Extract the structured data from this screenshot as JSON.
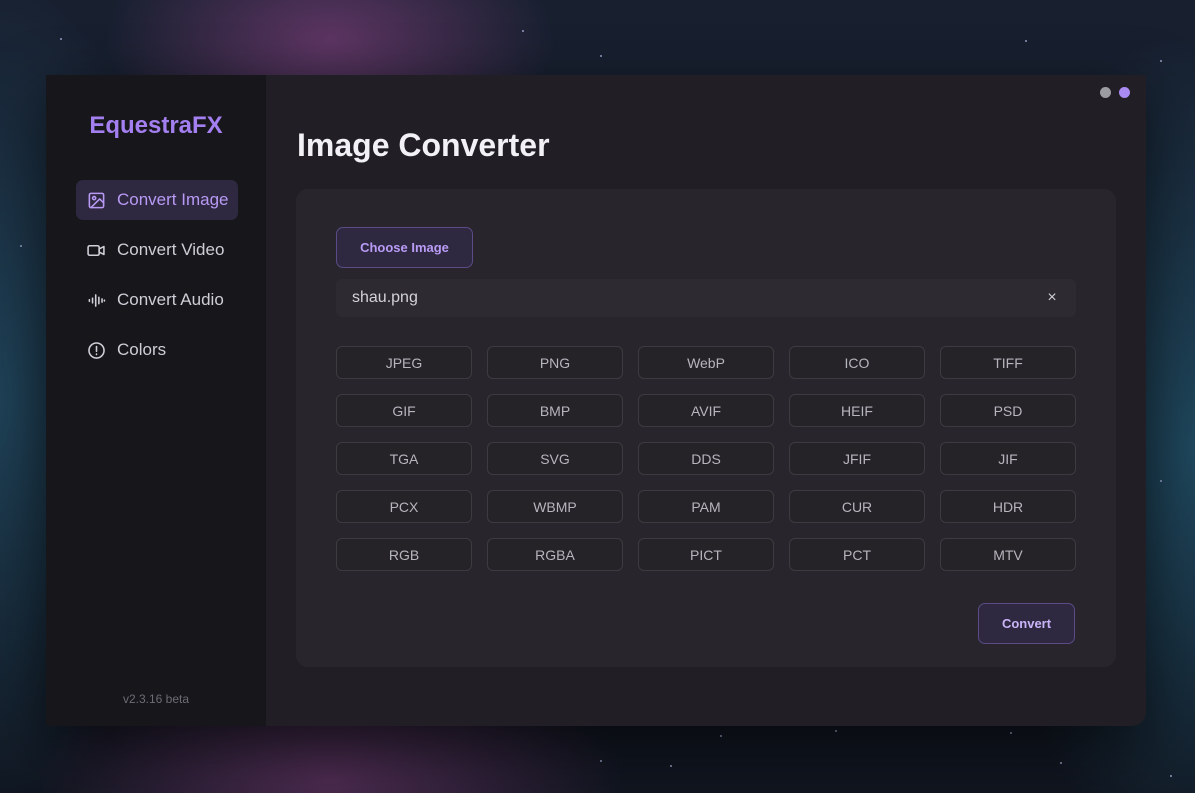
{
  "app": {
    "brand": "EquestraFX",
    "version": "v2.3.16 beta"
  },
  "sidebar": {
    "items": [
      {
        "label": "Convert Image",
        "icon": "image-icon",
        "active": true
      },
      {
        "label": "Convert Video",
        "icon": "video-camera-icon",
        "active": false
      },
      {
        "label": "Convert Audio",
        "icon": "audio-waveform-icon",
        "active": false
      },
      {
        "label": "Colors",
        "icon": "alert-circle-icon",
        "active": false
      }
    ]
  },
  "window_controls": {
    "dot1_color": "#9e9ca3",
    "dot2_color": "#a98bf2"
  },
  "main": {
    "title": "Image Converter",
    "choose_label": "Choose Image",
    "file_name": "shau.png",
    "clear_label": "×",
    "formats": [
      "JPEG",
      "PNG",
      "WebP",
      "ICO",
      "TIFF",
      "GIF",
      "BMP",
      "AVIF",
      "HEIF",
      "PSD",
      "TGA",
      "SVG",
      "DDS",
      "JFIF",
      "JIF",
      "PCX",
      "WBMP",
      "PAM",
      "CUR",
      "HDR",
      "RGB",
      "RGBA",
      "PICT",
      "PCT",
      "MTV"
    ],
    "convert_label": "Convert"
  },
  "colors": {
    "accent": "#a37ff0",
    "sidebar_bg": "#17161b",
    "main_bg": "#211f25",
    "panel_bg": "#28262c"
  }
}
